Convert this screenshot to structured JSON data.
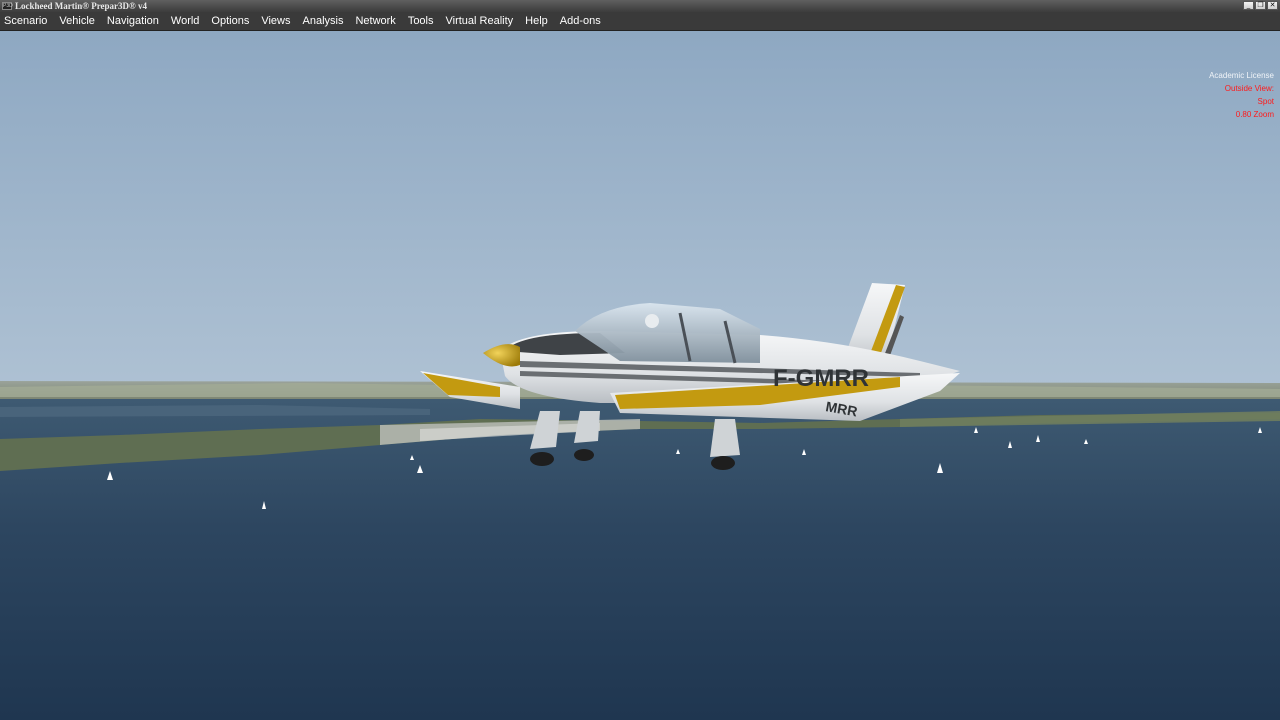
{
  "window": {
    "title": "Lockheed Martin® Prepar3D® v4",
    "icon": "p3d-app-icon",
    "controls": [
      "_",
      "❐",
      "✕"
    ]
  },
  "menu": {
    "items": [
      "Scenario",
      "Vehicle",
      "Navigation",
      "World",
      "Options",
      "Views",
      "Analysis",
      "Network",
      "Tools",
      "Virtual Reality",
      "Help",
      "Add-ons"
    ]
  },
  "hud": {
    "license": "Academic License",
    "view": "Outside View:",
    "camera": "Spot",
    "zoom": "0.80 Zoom",
    "info_color": "#ff1a1a"
  },
  "aircraft": {
    "registration": "F-GMRR",
    "wing_marking": "MRR",
    "color_fuselage": "#e9ecef",
    "color_stripe": "#c39a10"
  }
}
